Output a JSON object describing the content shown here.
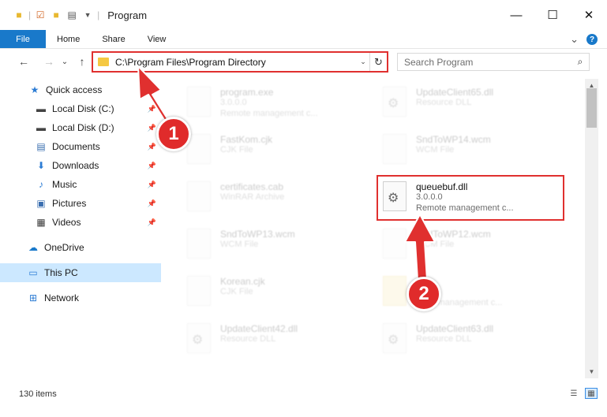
{
  "window": {
    "title": "Program",
    "controls": {
      "minimize": "—",
      "maximize": "☐",
      "close": "✕"
    }
  },
  "ribbon": {
    "tabs": [
      "File",
      "Home",
      "Share",
      "View"
    ],
    "collapse_glyph": "⌄",
    "help_glyph": "?"
  },
  "nav": {
    "back": "←",
    "forward": "→",
    "recent": "⌄",
    "up": "↑"
  },
  "address": {
    "path": "C:\\Program Files\\Program Directory",
    "dropdown_glyph": "⌄",
    "refresh_glyph": "↻"
  },
  "search": {
    "placeholder": "Search Program",
    "icon_glyph": "⌕"
  },
  "sidebar": {
    "items": [
      {
        "label": "Quick access",
        "icon": "star-icon",
        "glyph": "★",
        "color": "#2c7cd4"
      },
      {
        "label": "Local Disk (C:)",
        "icon": "drive-icon",
        "glyph": "▬",
        "color": "#444444",
        "pinned": true
      },
      {
        "label": "Local Disk (D:)",
        "icon": "drive-icon",
        "glyph": "▬",
        "color": "#444444",
        "pinned": true
      },
      {
        "label": "Documents",
        "icon": "documents-icon",
        "glyph": "▤",
        "color": "#3b6fb0",
        "pinned": true
      },
      {
        "label": "Downloads",
        "icon": "download-icon",
        "glyph": "⬇",
        "color": "#2c7cd4",
        "pinned": true
      },
      {
        "label": "Music",
        "icon": "music-icon",
        "glyph": "♪",
        "color": "#2c7cd4",
        "pinned": true
      },
      {
        "label": "Pictures",
        "icon": "pictures-icon",
        "glyph": "▣",
        "color": "#3b6fb0",
        "pinned": true
      },
      {
        "label": "Videos",
        "icon": "videos-icon",
        "glyph": "▦",
        "color": "#3b3b3b",
        "pinned": true
      },
      {
        "label": "OneDrive",
        "icon": "cloud-icon",
        "glyph": "☁",
        "color": "#1979ca"
      },
      {
        "label": "This PC",
        "icon": "computer-icon",
        "glyph": "▭",
        "color": "#2c7cd4",
        "selected": true
      },
      {
        "label": "Network",
        "icon": "network-icon",
        "glyph": "⊞",
        "color": "#2c7cd4"
      }
    ],
    "pin_glyph": "📌"
  },
  "files": [
    {
      "name": "program.exe",
      "line2": "3.0.0.0",
      "line3": "Remote management c...",
      "icon": "exe-icon"
    },
    {
      "name": "UpdateClient65.dll",
      "line2": "Resource DLL",
      "icon": "dll-icon"
    },
    {
      "name": "FastKom.cjk",
      "line2": "CJK File",
      "icon": "file-icon"
    },
    {
      "name": "SndToWP14.wcm",
      "line2": "WCM File",
      "icon": "file-icon"
    },
    {
      "name": "certificates.cab",
      "line2": "WinRAR Archive",
      "icon": "archive-icon"
    },
    {
      "name": "queuebuf.dll",
      "line2": "3.0.0.0",
      "line3": "Remote management c...",
      "icon": "dll-icon",
      "highlighted": true
    },
    {
      "name": "SndToWP13.wcm",
      "line2": "WCM File",
      "icon": "file-icon"
    },
    {
      "name": "SndToWP12.wcm",
      "line2": "WCM File",
      "icon": "file-icon"
    },
    {
      "name": "Korean.cjk",
      "line2": "CJK File",
      "icon": "file-icon"
    },
    {
      "name": "",
      "line2": "",
      "line3": "...ote management c...",
      "icon": "folder-icon"
    },
    {
      "name": "UpdateClient42.dll",
      "line2": "Resource DLL",
      "icon": "dll-icon"
    },
    {
      "name": "UpdateClient63.dll",
      "line2": "Resource DLL",
      "icon": "dll-icon"
    }
  ],
  "status": {
    "count": "130 items"
  },
  "annotations": {
    "badge1": "1",
    "badge2": "2",
    "color": "#e0302f"
  }
}
